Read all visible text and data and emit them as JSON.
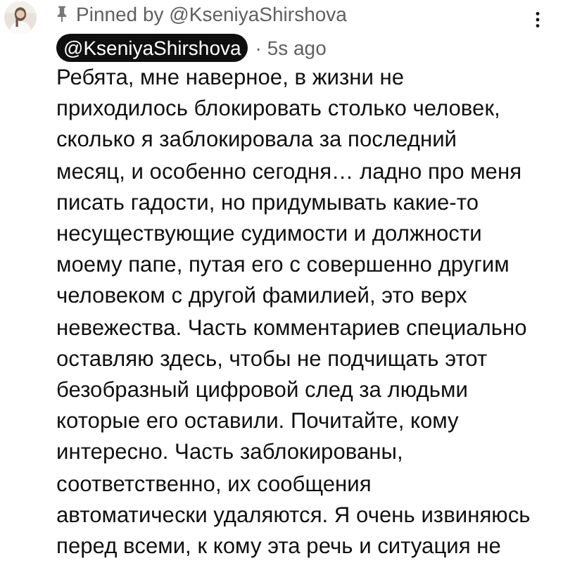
{
  "comment": {
    "pinned_label": "Pinned by @KseniyaShirshova",
    "author": "@KseniyaShirshova",
    "time": "· 5s ago",
    "lines": [
      "Ребята, мне наверное, в жизни не",
      "приходилось блокировать столько человек,",
      "сколько я заблокировала за последний",
      "месяц, и особенно сегодня… ладно про меня",
      "писать гадости, но придумывать какие-то",
      "несуществующие судимости и должности",
      "моему папе, путая его с совершенно другим",
      "человеком с другой фамилией, это верх",
      "невежества. Часть комментариев специально",
      "оставляю здесь, чтобы не подчищать этот",
      "безобразный цифровой след за людьми",
      "которые его оставили. Почитайте, кому",
      "интересно. Часть заблокированы,",
      "соответственно, их сообщения",
      "автоматически удаляются. Я очень извиняюсь",
      "перед всеми, к кому эта речь и ситуация не"
    ]
  }
}
